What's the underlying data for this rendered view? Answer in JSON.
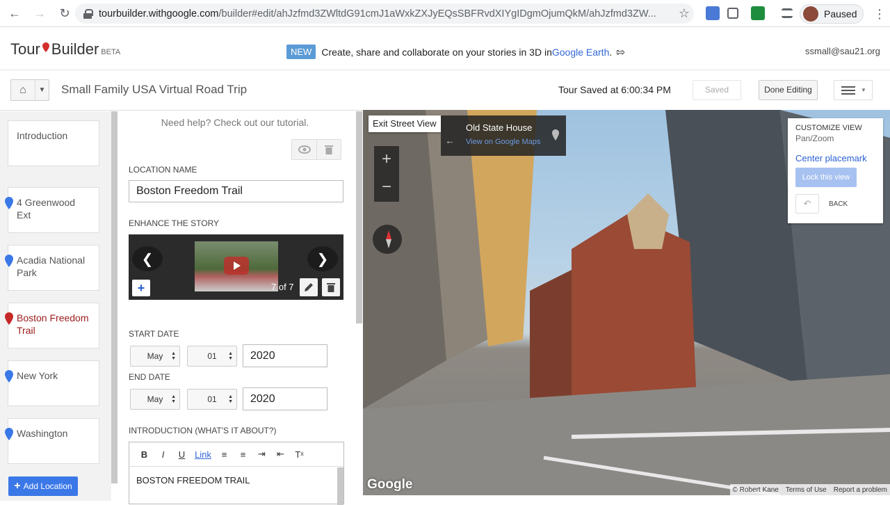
{
  "browser": {
    "url_host": "tourbuilder.withgoogle.com",
    "url_path": "/builder#edit/ahJzfmd3ZWltdG91cmJ1aWxkZXJyEQsSBFRvdXIYgIDgmOjumQkM/ahJzfmd3ZW...",
    "profile_status": "Paused"
  },
  "header": {
    "logo_tour": "Tour",
    "logo_builder": "Builder",
    "logo_beta": "BETA",
    "new_badge": "NEW",
    "announce_text": "Create, share and collaborate on your stories in 3D in ",
    "announce_link": "Google Earth",
    "announce_end": ".",
    "user_email": "ssmall@sau21.org"
  },
  "toolbar": {
    "tour_title": "Small Family USA Virtual Road Trip",
    "saved_status": "Tour Saved at 6:00:34 PM",
    "saved_label": "Saved",
    "done_label": "Done Editing"
  },
  "stops": {
    "items": [
      {
        "label": "Introduction",
        "pin": false,
        "active": false
      },
      {
        "label": "4 Greenwood Ext",
        "pin": true,
        "active": false
      },
      {
        "label": "Acadia National Park",
        "pin": true,
        "active": false
      },
      {
        "label": "Boston Freedom Trail",
        "pin": true,
        "active": true
      },
      {
        "label": "New York",
        "pin": true,
        "active": false
      },
      {
        "label": "Washington",
        "pin": true,
        "active": false
      }
    ],
    "add_label": "Add Location"
  },
  "editor": {
    "help_text": "Need help? Check out our tutorial.",
    "location_name_label": "LOCATION NAME",
    "location_name_value": "Boston Freedom Trail",
    "enhance_label": "ENHANCE THE STORY",
    "media_count": "7 of 7",
    "start_date_label": "START DATE",
    "start_month": "May",
    "start_day": "01",
    "start_year": "2020",
    "end_date_label": "END DATE",
    "end_month": "May",
    "end_day": "01",
    "end_year": "2020",
    "intro_label": "INTRODUCTION (WHAT'S IT ABOUT?)",
    "rte_link": "Link",
    "rte_body": "BOSTON FREEDOM TRAIL"
  },
  "streetview": {
    "exit_label": "Exit Street View",
    "place_name": "Old State House",
    "maps_link": "View on Google Maps",
    "customize_title": "CUSTOMIZE VIEW",
    "customize_mode": "Pan/Zoom",
    "center_placemark": "Center placemark",
    "lock_view": "Lock this view",
    "back_label": "BACK",
    "google_logo": "Google",
    "attrib_author": "© Robert Kane",
    "attrib_terms": "Terms of Use",
    "attrib_report": "Report a problem"
  },
  "colors": {
    "accent_blue": "#3b78e7",
    "active_stop": "#9b1b1b",
    "pin_blue": "#3b78e7",
    "pin_red": "#c62828"
  }
}
